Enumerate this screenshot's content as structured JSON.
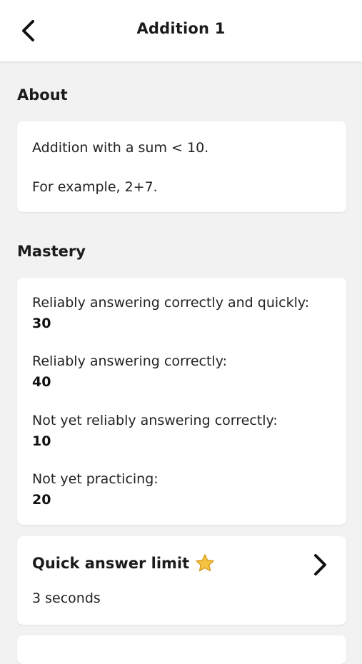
{
  "header": {
    "title": "Addition 1",
    "back_icon": "chevron-left-icon"
  },
  "about": {
    "section_title": "About",
    "line1": "Addition with a sum < 10.",
    "line2": "For example, 2+7."
  },
  "mastery": {
    "section_title": "Mastery",
    "items": [
      {
        "label": "Reliably answering correctly and quickly:",
        "value": "30"
      },
      {
        "label": "Reliably answering correctly:",
        "value": "40"
      },
      {
        "label": "Not yet reliably answering correctly:",
        "value": "10"
      },
      {
        "label": "Not yet practicing:",
        "value": "20"
      }
    ]
  },
  "quick_answer": {
    "title": "Quick answer limit",
    "star_icon": "star-icon",
    "value": "3 seconds",
    "chevron_icon": "chevron-right-icon"
  },
  "colors": {
    "background": "#f2f2f2",
    "card": "#ffffff",
    "text": "#1b1b1b",
    "star": "#f6c343"
  }
}
